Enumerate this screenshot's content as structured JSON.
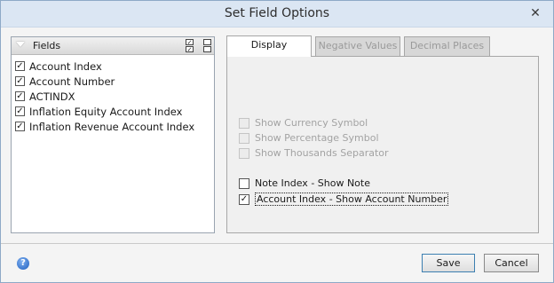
{
  "window": {
    "title": "Set Field Options",
    "close_glyph": "✕"
  },
  "fields": {
    "header_label": "Fields",
    "items": [
      {
        "label": "Account Index",
        "checked": true
      },
      {
        "label": "Account Number",
        "checked": true
      },
      {
        "label": "ACTINDX",
        "checked": true
      },
      {
        "label": "Inflation Equity Account Index",
        "checked": true
      },
      {
        "label": "Inflation Revenue Account Index",
        "checked": true
      }
    ]
  },
  "tabs": [
    {
      "label": "Display",
      "active": true,
      "enabled": true
    },
    {
      "label": "Negative Values",
      "active": false,
      "enabled": false
    },
    {
      "label": "Decimal Places",
      "active": false,
      "enabled": false
    }
  ],
  "display_options": {
    "currency": {
      "label": "Show Currency Symbol",
      "checked": false,
      "enabled": false
    },
    "percent": {
      "label": "Show Percentage Symbol",
      "checked": false,
      "enabled": false
    },
    "thousands": {
      "label": "Show Thousands Separator",
      "checked": false,
      "enabled": false
    },
    "note": {
      "label": "Note Index - Show Note",
      "checked": false,
      "enabled": true
    },
    "account": {
      "label": "Account Index - Show Account Number",
      "checked": true,
      "enabled": true
    }
  },
  "footer": {
    "save_label": "Save",
    "cancel_label": "Cancel",
    "help_glyph": "?"
  },
  "icons": {
    "collapse": "collapse-icon",
    "select_all": "select-all-icon",
    "select_none": "select-none-icon",
    "help": "help-icon"
  },
  "colors": {
    "titlebar": "#dbe6f3",
    "save_border": "#3c7fb1",
    "help": "#1f5fbf"
  }
}
